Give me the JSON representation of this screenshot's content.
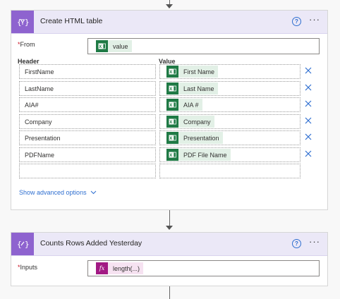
{
  "card1": {
    "title": "Create HTML table",
    "help_icon": "?",
    "more_icon": "···",
    "from": {
      "label": "From",
      "required": "*",
      "token": "value",
      "token_icon": "excel-icon"
    },
    "table": {
      "header_label": "Header",
      "value_label": "Value",
      "rows": [
        {
          "header": "FirstName",
          "value": "First Name"
        },
        {
          "header": "LastName",
          "value": "Last Name"
        },
        {
          "header": "AIA#",
          "value": "AIA #"
        },
        {
          "header": "Company",
          "value": "Company"
        },
        {
          "header": "Presentation",
          "value": "Presentation"
        },
        {
          "header": "PDFName",
          "value": "PDF File Name"
        }
      ]
    },
    "advanced_options": "Show advanced options"
  },
  "card2": {
    "title": "Counts Rows Added Yesterday",
    "help_icon": "?",
    "more_icon": "···",
    "inputs": {
      "label": "Inputs",
      "required": "*",
      "token": "length(...)",
      "token_icon": "fx"
    }
  },
  "colors": {
    "action_purple": "#8e63cf",
    "header_bg": "#ebe8f7",
    "excel_green": "#1f7a45",
    "link_blue": "#2f6fd0",
    "fx_magenta": "#a21a84"
  }
}
